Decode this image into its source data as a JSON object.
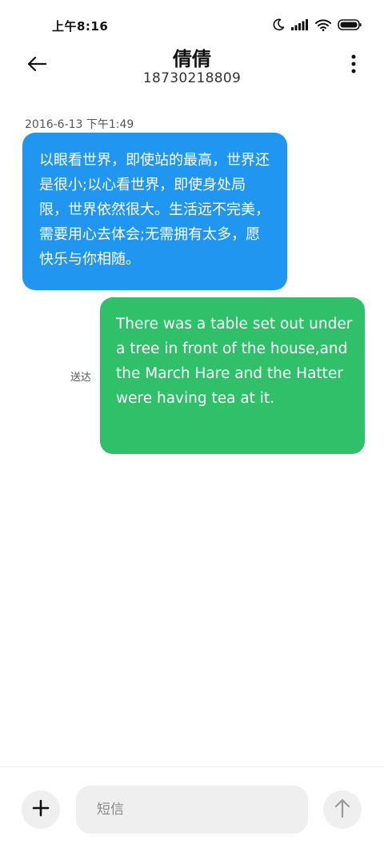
{
  "status_bar": {
    "time": "上午8:16",
    "icons": [
      "moon-icon",
      "signal-icon",
      "wifi-icon",
      "battery-icon"
    ]
  },
  "header": {
    "back_icon": "arrow-left-icon",
    "contact_name": "倩倩",
    "contact_number": "18730218809",
    "more_icon": "vertical-dots-icon"
  },
  "conversation": {
    "timestamp": "2016-6-13 下午1:49",
    "messages": [
      {
        "direction": "incoming",
        "text": "以眼看世界，即使站的最高，世界还是很小;以心看世界，即使身处局限，世界依然很大。生活远不完美，需要用心去体会;无需拥有太多，愿快乐与你相随。",
        "color": "#2196f0"
      },
      {
        "direction": "outgoing",
        "text": "There was a table set out under a tree in front of the house,and the March Hare and the Hatter were having tea at it.",
        "status": "送达",
        "color": "#30c06a"
      }
    ]
  },
  "compose": {
    "add_icon": "plus-icon",
    "placeholder": "短信",
    "value": "",
    "send_icon": "arrow-up-icon"
  }
}
